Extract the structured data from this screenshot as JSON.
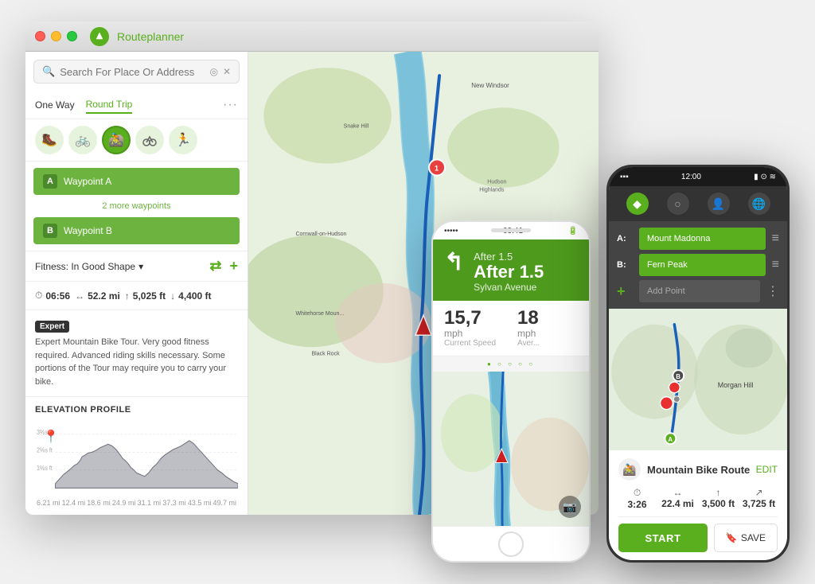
{
  "app": {
    "title": "Routeplanner",
    "logo_symbol": "⌃"
  },
  "search": {
    "placeholder": "Search For Place Or Address"
  },
  "route_tabs": [
    {
      "id": "one-way",
      "label": "One Way",
      "active": false
    },
    {
      "id": "round-trip",
      "label": "Round Trip",
      "active": true
    }
  ],
  "activities": [
    {
      "id": "hike",
      "symbol": "🥾",
      "active": false
    },
    {
      "id": "bike",
      "symbol": "🚲",
      "active": false
    },
    {
      "id": "mtb",
      "symbol": "🚵",
      "active": true
    },
    {
      "id": "road-bike",
      "symbol": "🏍",
      "active": false
    },
    {
      "id": "run",
      "symbol": "🏃",
      "active": false
    }
  ],
  "waypoints": [
    {
      "label": "A",
      "name": "Waypoint A"
    },
    {
      "label": "B",
      "name": "Waypoint B"
    }
  ],
  "more_waypoints": "2 more waypoints",
  "fitness": {
    "label": "Fitness: In Good Shape",
    "chevron": "▾"
  },
  "stats": [
    {
      "icon": "⏱",
      "value": "06:56"
    },
    {
      "icon": "↔",
      "value": "52.2 mi"
    },
    {
      "icon": "↑",
      "value": "5,025 ft"
    },
    {
      "icon": "↓",
      "value": "4,400 ft"
    }
  ],
  "difficulty": {
    "badge": "Expert",
    "description": "Expert Mountain Bike Tour. Very good fitness required. Advanced riding skills necessary. Some portions of the Tour may require you to carry your bike."
  },
  "elevation": {
    "title": "ELEVATION PROFILE",
    "labels": [
      "6.21 mi",
      "12.4 mi",
      "18.6 mi",
      "24.9 mi",
      "31.1 mi",
      "37.3 mi",
      "43.5 mi",
      "49.7 mi"
    ]
  },
  "phone_white": {
    "status_time": "09:41",
    "nav_after": "After 1.5",
    "nav_street": "Sylvan Avenue",
    "speed_value": "15,7",
    "speed_unit": "mph",
    "speed_label": "Current Speed",
    "avg_value": "18",
    "avg_label": "Aver..."
  },
  "phone_black": {
    "status_time": "12:00",
    "waypoint_a": "Mount Madonna",
    "waypoint_b": "Fern Peak",
    "add_point": "Add Point",
    "route_name": "Mountain Bike Route",
    "edit_label": "EDIT",
    "metrics": [
      {
        "icon": "⏱",
        "value": "3:26",
        "label": ""
      },
      {
        "icon": "↔",
        "value": "22.4 mi",
        "label": ""
      },
      {
        "icon": "↑",
        "value": "3,500 ft",
        "label": ""
      },
      {
        "icon": "↗",
        "value": "3,725 ft",
        "label": ""
      }
    ],
    "start_label": "START",
    "save_label": "SAVE"
  }
}
